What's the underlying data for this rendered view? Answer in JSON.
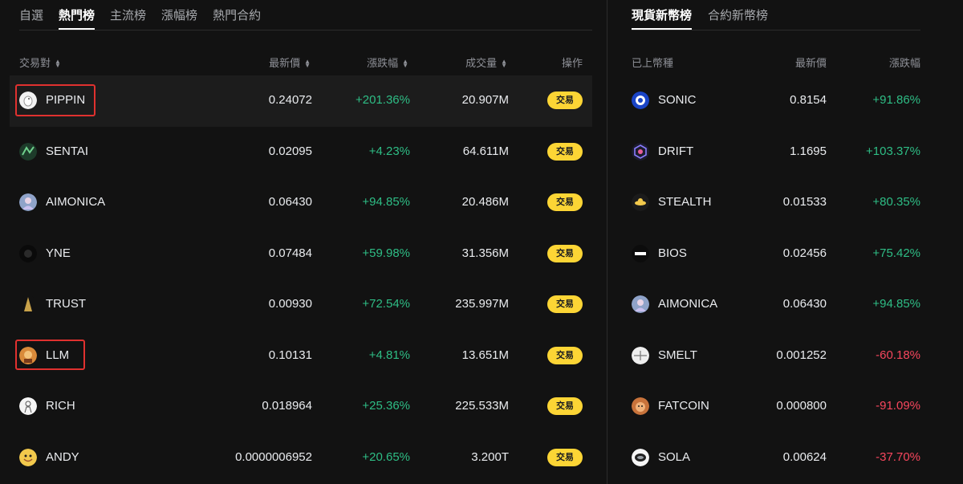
{
  "left_tabs": [
    "自選",
    "熱門榜",
    "主流榜",
    "漲幅榜",
    "熱門合約"
  ],
  "right_tabs": [
    "現貨新幣榜",
    "合約新幣榜"
  ],
  "left_headers": {
    "pair": "交易對",
    "price": "最新價",
    "change": "漲跌幅",
    "volume": "成交量",
    "action": "操作"
  },
  "right_headers": {
    "coin": "已上幣種",
    "price": "最新價",
    "change": "漲跌幅"
  },
  "hot_list": [
    {
      "symbol": "PIPPIN",
      "price": "0.24072",
      "change": "+201.36%",
      "volume": "20.907M",
      "trade": "交易",
      "icon": "pippin-icon"
    },
    {
      "symbol": "SENTAI",
      "price": "0.02095",
      "change": "+4.23%",
      "volume": "64.611M",
      "trade": "交易",
      "icon": "sentai-icon"
    },
    {
      "symbol": "AIMONICA",
      "price": "0.06430",
      "change": "+94.85%",
      "volume": "20.486M",
      "trade": "交易",
      "icon": "aimonica-icon"
    },
    {
      "symbol": "YNE",
      "price": "0.07484",
      "change": "+59.98%",
      "volume": "31.356M",
      "trade": "交易",
      "icon": "yne-icon"
    },
    {
      "symbol": "TRUST",
      "price": "0.00930",
      "change": "+72.54%",
      "volume": "235.997M",
      "trade": "交易",
      "icon": "trust-icon"
    },
    {
      "symbol": "LLM",
      "price": "0.10131",
      "change": "+4.81%",
      "volume": "13.651M",
      "trade": "交易",
      "icon": "llm-icon"
    },
    {
      "symbol": "RICH",
      "price": "0.018964",
      "change": "+25.36%",
      "volume": "225.533M",
      "trade": "交易",
      "icon": "rich-icon"
    },
    {
      "symbol": "ANDY",
      "price": "0.0000006952",
      "change": "+20.65%",
      "volume": "3.200T",
      "trade": "交易",
      "icon": "andy-icon"
    }
  ],
  "new_list": [
    {
      "symbol": "SONIC",
      "price": "0.8154",
      "change": "+91.86%",
      "icon": "sonic-icon"
    },
    {
      "symbol": "DRIFT",
      "price": "1.1695",
      "change": "+103.37%",
      "icon": "drift-icon"
    },
    {
      "symbol": "STEALTH",
      "price": "0.01533",
      "change": "+80.35%",
      "icon": "stealth-icon"
    },
    {
      "symbol": "BIOS",
      "price": "0.02456",
      "change": "+75.42%",
      "icon": "bios-icon"
    },
    {
      "symbol": "AIMONICA",
      "price": "0.06430",
      "change": "+94.85%",
      "icon": "aimonica-icon"
    },
    {
      "symbol": "SMELT",
      "price": "0.001252",
      "change": "-60.18%",
      "icon": "smelt-icon"
    },
    {
      "symbol": "FATCOIN",
      "price": "0.000800",
      "change": "-91.09%",
      "icon": "fatcoin-icon"
    },
    {
      "symbol": "SOLA",
      "price": "0.00624",
      "change": "-37.70%",
      "icon": "sola-icon"
    }
  ],
  "colors": {
    "up": "#2ebd85",
    "down": "#f6465d",
    "accent": "#fcd535",
    "highlight_box": "#e0312f"
  },
  "icon_svgs": {
    "pippin-icon": "<svg viewBox='0 0 22 22'><circle cx='11' cy='11' r='11' fill='#f2f2f2'/><ellipse cx='11' cy='12' rx='5' ry='6' fill='#fff' stroke='#999' stroke-width='1'/><circle cx='12' cy='9' r='1' fill='#555'/></svg>",
    "sentai-icon": "<svg viewBox='0 0 22 22'><circle cx='11' cy='11' r='11' fill='#1d3b2a'/><path d='M4 15 L9 6 L13 12 L18 5' stroke='#6fd08c' stroke-width='2' fill='none'/></svg>",
    "aimonica-icon": "<svg viewBox='0 0 22 22'><circle cx='11' cy='11' r='11' fill='#8fa3c9'/><circle cx='11' cy='9' r='4' fill='#e8d4e6'/><path d='M4 20 Q11 11 18 20' fill='#c9c0ef'/></svg>",
    "yne-icon": "<svg viewBox='0 0 22 22'><circle cx='11' cy='11' r='11' fill='#0a0a0a'/><circle cx='11' cy='11' r='5' fill='#2a2a2a'/></svg>",
    "trust-icon": "<svg viewBox='0 0 22 22'><circle cx='11' cy='11' r='11' fill='#121212'/><path d='M11 2 L16 20 L6 20 Z' fill='#c9a24a'/></svg>",
    "llm-icon": "<svg viewBox='0 0 22 22'><circle cx='11' cy='11' r='11' fill='#d98a3a'/><circle cx='11' cy='10' r='5' fill='#f3c27a'/><rect x='6' y='15' width='10' height='5' fill='#7a3b1a'/></svg>",
    "rich-icon": "<svg viewBox='0 0 22 22'><circle cx='11' cy='11' r='11' fill='#f5f5f5'/><circle cx='11' cy='8' r='3' fill='none' stroke='#555' stroke-width='1'/><path d='M7 19 L9 12 L13 12 L15 19' fill='none' stroke='#555' stroke-width='1'/></svg>",
    "andy-icon": "<svg viewBox='0 0 22 22'><circle cx='11' cy='11' r='11' fill='#f2c94c'/><circle cx='8' cy='9' r='1.5' fill='#222'/><circle cx='14' cy='9' r='1.5' fill='#222'/><path d='M6 13 Q11 18 16 13' stroke='#a0522d' stroke-width='1.5' fill='none'/></svg>",
    "sonic-icon": "<svg viewBox='0 0 22 22'><circle cx='11' cy='11' r='11' fill='#1a44c6'/><circle cx='11' cy='11' r='6' fill='#fff'/><circle cx='11' cy='11' r='3' fill='#1a44c6'/></svg>",
    "drift-icon": "<svg viewBox='0 0 22 22'><circle cx='11' cy='11' r='11' fill='#1c1c2e'/><path d='M11 3 L18 7 L18 15 L11 19 L4 15 L4 7 Z' fill='none' stroke='#8a7cff' stroke-width='1.6'/><circle cx='11' cy='11' r='3' fill='#e85d9a'/></svg>",
    "stealth-icon": "<svg viewBox='0 0 22 22'><circle cx='11' cy='11' r='11' fill='#1b1b1b'/><ellipse cx='11' cy='12' rx='7' ry='3' fill='#f2c94c'/><circle cx='11' cy='9' r='3' fill='#f2c94c'/></svg>",
    "bios-icon": "<svg viewBox='0 0 22 22'><circle cx='11' cy='11' r='11' fill='#0c0c0c'/><rect x='4' y='9' width='14' height='4' fill='#ffffff'/></svg>",
    "smelt-icon": "<svg viewBox='0 0 22 22'><circle cx='11' cy='11' r='11' fill='#eeeeee'/><path d='M3 11 L19 11 M11 5 L11 17' stroke='#777' stroke-width='1.2'/></svg>",
    "fatcoin-icon": "<svg viewBox='0 0 22 22'><circle cx='11' cy='11' r='11' fill='#c8733b'/><circle cx='11' cy='12' r='6' fill='#f0b27a'/><circle cx='9' cy='11' r='1' fill='#222'/><circle cx='13' cy='11' r='1' fill='#222'/></svg>",
    "sola-icon": "<svg viewBox='0 0 22 22'><circle cx='11' cy='11' r='11' fill='#f5f5f5'/><ellipse cx='11' cy='11' rx='7' ry='5' fill='#222'/><ellipse cx='11' cy='11' rx='4' ry='2' fill='#9aa0a6'/></svg>"
  }
}
